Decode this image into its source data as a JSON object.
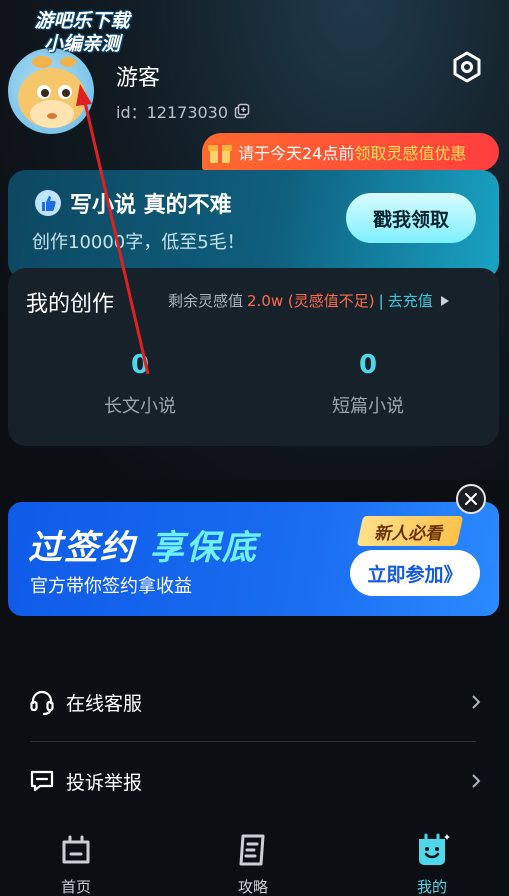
{
  "watermark": {
    "line1": "游吧乐下载",
    "line2": "小编亲测"
  },
  "profile": {
    "name": "游客",
    "id_text": "id：12173030"
  },
  "promo_badge": {
    "prefix": "请于今天24点前",
    "highlight": "领取灵感值优惠"
  },
  "write_card": {
    "title": "写小说 真的不难",
    "subtitle": "创作10000字，低至5毛！",
    "claim_label": "戳我领取"
  },
  "creations": {
    "heading": "我的创作",
    "remain_label": "剩余灵感值",
    "remain_amount": "2.0w (灵感值不足)",
    "separator": "|",
    "recharge_link": "去充值",
    "stats": [
      {
        "value": "0",
        "label": "长文小说"
      },
      {
        "value": "0",
        "label": "短篇小说"
      }
    ]
  },
  "ad": {
    "headline_a": "过签约",
    "headline_b": "享保底",
    "sub": "官方带你签约拿收益",
    "tag": "新人必看",
    "join_label": "立即参加》"
  },
  "menu": [
    {
      "label": "在线客服",
      "icon": "headset-icon"
    },
    {
      "label": "投诉举报",
      "icon": "report-icon"
    }
  ],
  "tabs": [
    {
      "label": "首页",
      "icon": "home-icon"
    },
    {
      "label": "攻略",
      "icon": "guide-icon"
    },
    {
      "label": "我的",
      "icon": "smile-icon"
    }
  ],
  "colors": {
    "accent": "#4dd7e8",
    "warning": "#ff6a4a",
    "banner": "#1a6cf0"
  }
}
